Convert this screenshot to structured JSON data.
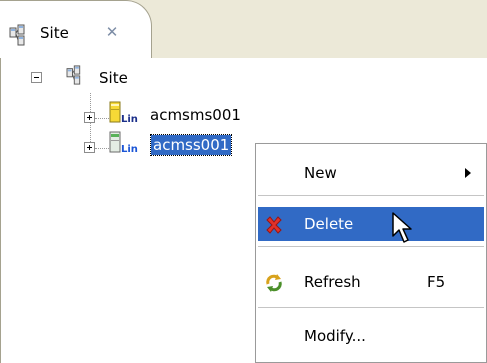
{
  "tab": {
    "label": "Site",
    "close_glyph": "✕"
  },
  "tree": {
    "root_label": "Site",
    "children": [
      {
        "name": "acmsms001",
        "tag": "Lin",
        "expander": "plus"
      },
      {
        "name": "acmss001",
        "tag": "Lin",
        "expander": "plus",
        "selected": true
      }
    ]
  },
  "context_menu": {
    "items": [
      {
        "label": "New",
        "submenu": true
      },
      {
        "label": "Delete",
        "icon": "red-x-icon",
        "hovered": true
      },
      {
        "label": "Refresh",
        "shortcut": "F5",
        "icon": "refresh-icon"
      },
      {
        "label": "Modify..."
      }
    ]
  },
  "colors": {
    "selection": "#316ac5",
    "tab_strip": "#ece9d8",
    "lin_tag": "#1b2f8a"
  }
}
